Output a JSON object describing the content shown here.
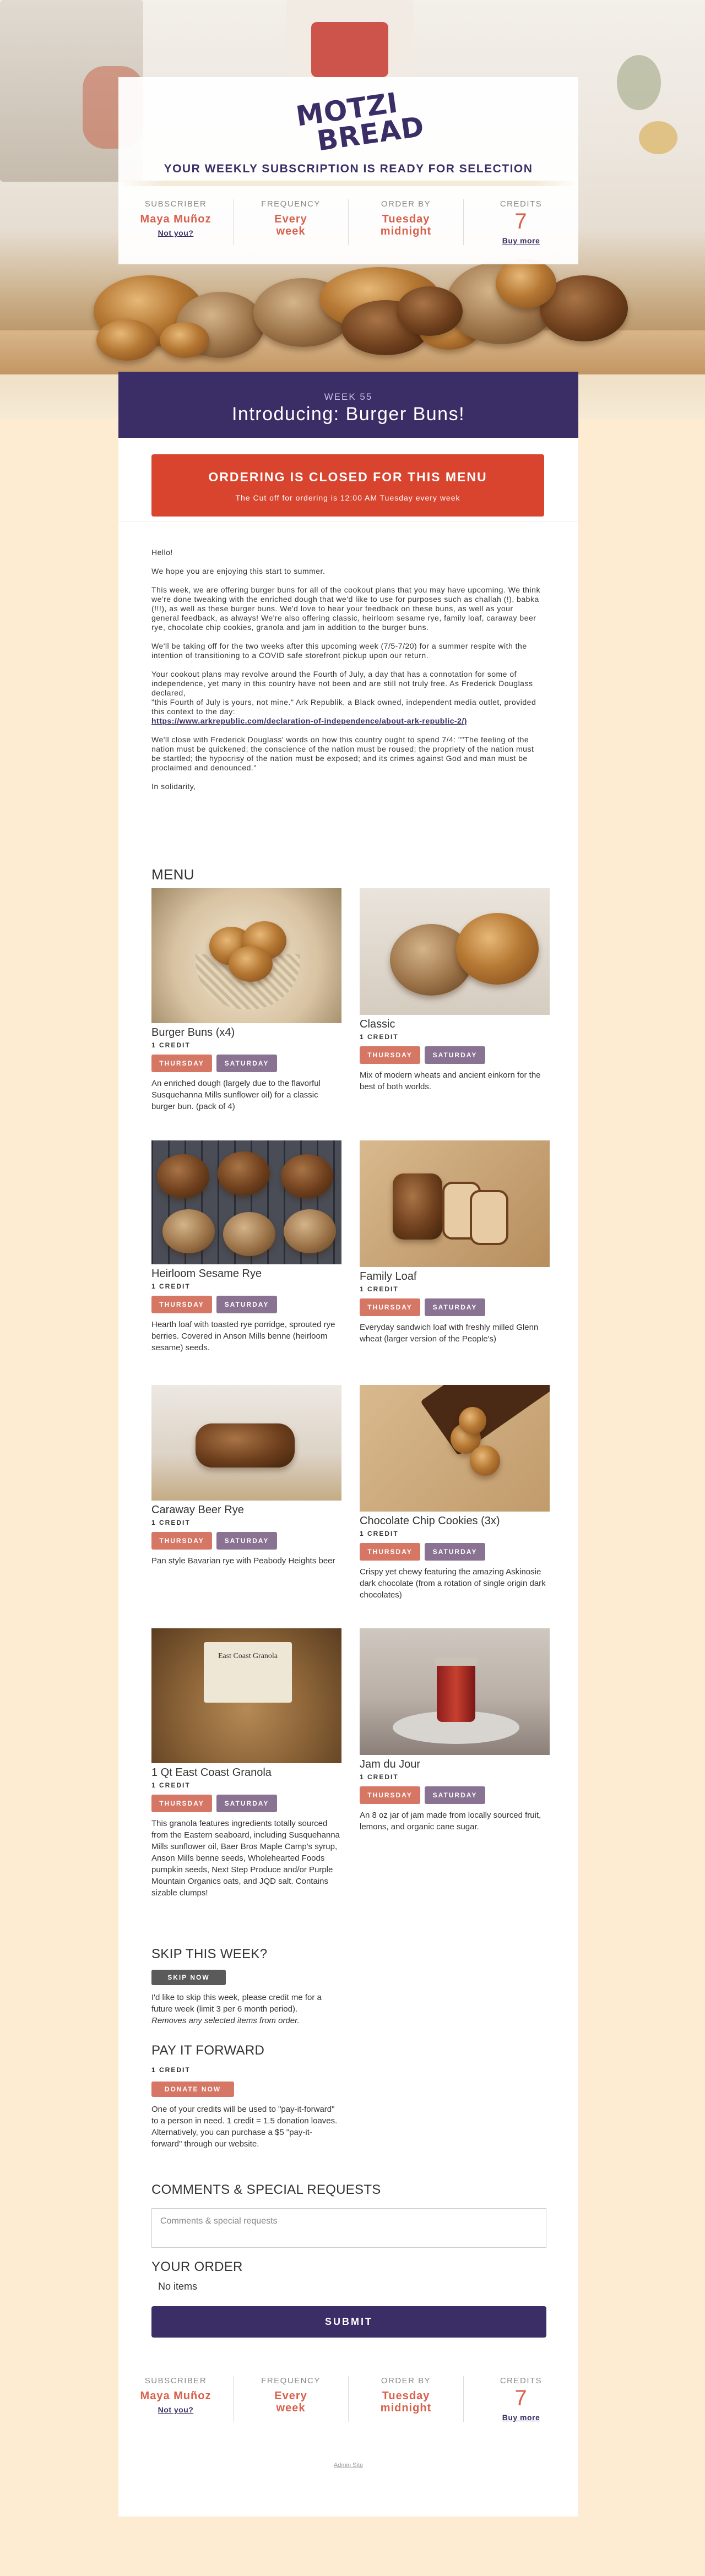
{
  "brand": {
    "logo_line1": "MOTZI",
    "logo_line2": "BREAD",
    "tagline": "YOUR WEEKLY SUBSCRIPTION IS READY FOR SELECTION"
  },
  "colors": {
    "purple": "#3b2d66",
    "coral": "#d9604a",
    "closed_red": "#d9442f",
    "thursday": "#d67766",
    "saturday": "#8a7392",
    "background": "#fdebd2"
  },
  "summary": {
    "subscriber_label": "SUBSCRIBER",
    "subscriber_name": "Maya Muñoz",
    "not_you": "Not you?",
    "frequency_label": "FREQUENCY",
    "frequency_line1": "Every",
    "frequency_line2": "week",
    "order_by_label": "ORDER BY",
    "order_by_line1": "Tuesday",
    "order_by_line2": "midnight",
    "credits_label": "CREDITS",
    "credits_value": "7",
    "buy_more": "Buy more"
  },
  "week": {
    "label": "WEEK 55",
    "title": "Introducing: Burger Buns!"
  },
  "closed": {
    "heading": "ORDERING IS CLOSED FOR THIS MENU",
    "sub": "The Cut off for ordering is 12:00 AM Tuesday every week"
  },
  "letter": {
    "p1": "Hello!",
    "p2": "We hope you are enjoying this start to summer.",
    "p3": "This week, we are offering burger buns for all of the cookout plans that you may have upcoming. We think we're done tweaking with the enriched dough that we'd like to use for purposes such as challah (!), babka (!!!), as well as these burger buns. We'd love to hear your feedback on these buns, as well as your general feedback, as always! We're also offering classic, heirloom sesame rye, family loaf, caraway beer rye, chocolate chip cookies, granola and jam in addition to the burger buns.",
    "p4": "We'll be taking off for the two weeks after this upcoming week (7/5-7/20) for a summer respite with the intention of transitioning to a COVID safe storefront pickup upon our return.",
    "p5a": "Your cookout plans may revolve around the Fourth of July, a day that has a connotation for some of independence, yet many in this country have not been and are still not truly free. As Frederick Douglass declared,",
    "p5b": "\"this Fourth of July is yours, not mine.\" Ark Republik, a Black owned, independent media outlet, provided this context to the day:",
    "p5_link": "https://www.arkrepublic.com/declaration-of-independence/about-ark-republic-2/)",
    "p6": "We'll close with Frederick Douglass' words on how this country ought to spend 7/4: \"\"The feeling of the nation must be quickened; the conscience of the nation must be roused; the propriety of the nation must be startled; the hypocrisy of the nation must be exposed; and its crimes against God and man must be proclaimed and denounced.\"",
    "p7": "In solidarity,"
  },
  "menu": {
    "heading": "MENU",
    "thursday_label": "THURSDAY",
    "saturday_label": "SATURDAY",
    "items": [
      {
        "name": "Burger Buns (x4)",
        "credits": "1 CREDIT",
        "desc": "An enriched dough (largely due to the flavorful Susquehanna Mills sunflower oil) for a classic burger bun. (pack of 4)"
      },
      {
        "name": "Classic",
        "credits": "1 CREDIT",
        "desc": "Mix of modern wheats and ancient einkorn for the best of both worlds."
      },
      {
        "name": "Heirloom Sesame Rye",
        "credits": "1 CREDIT",
        "desc": "Hearth loaf with toasted rye porridge, sprouted rye berries. Covered in Anson Mills benne (heirloom sesame) seeds."
      },
      {
        "name": "Family Loaf",
        "credits": "1 CREDIT",
        "desc": "Everyday sandwich loaf with freshly milled Glenn wheat (larger version of the People's)"
      },
      {
        "name": "Caraway Beer Rye",
        "credits": "1 CREDIT",
        "desc": "Pan style Bavarian rye with Peabody Heights beer"
      },
      {
        "name": "Chocolate Chip Cookies (3x)",
        "credits": "1 CREDIT",
        "desc": "Crispy yet chewy featuring the amazing Askinosie dark chocolate (from a rotation of single origin dark chocolates)"
      },
      {
        "name": "1 Qt East Coast Granola",
        "credits": "1 CREDIT",
        "desc": "This granola features ingredients totally sourced from the Eastern seaboard, including Susquehanna Mills sunflower oil, Baer Bros Maple Camp's syrup, Anson Mills benne seeds, Wholehearted Foods pumpkin seeds, Next Step Produce and/or Purple Mountain Organics oats, and JQD salt. Contains sizable clumps!",
        "label_text": "East Coast Granola"
      },
      {
        "name": "Jam du Jour",
        "credits": "1 CREDIT",
        "desc": "An 8 oz jar of jam made from locally sourced fruit, lemons, and organic cane sugar."
      }
    ]
  },
  "skip": {
    "heading": "SKIP THIS WEEK?",
    "button": "SKIP NOW",
    "text": "I'd like to skip this week, please credit me for a future week (limit 3 per 6 month period).",
    "note": "Removes any selected items from order."
  },
  "pay_forward": {
    "heading": "PAY IT FORWARD",
    "credits": "1 CREDIT",
    "button": "DONATE NOW",
    "text": "One of your credits will be used to \"pay-it-forward\" to a person in need. 1 credit = 1.5 donation loaves. Alternatively, you can purchase a $5 \"pay-it-forward\" through our website."
  },
  "comments": {
    "heading": "COMMENTS & SPECIAL REQUESTS",
    "placeholder": "Comments & special requests"
  },
  "order": {
    "heading": "YOUR ORDER",
    "empty": "No items",
    "submit": "SUBMIT"
  },
  "footer": {
    "admin": "Admin Site"
  }
}
